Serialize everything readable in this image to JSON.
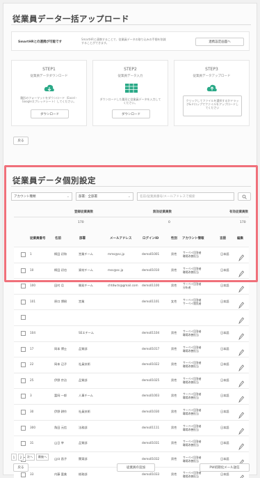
{
  "bulk": {
    "title": "従業員データ一括アップロード",
    "smarthr_label": "SmartHRとの連携が可能です",
    "smarthr_desc": "SmartHRと連携することで、従業員データの取り込みの手間を削減することができます。",
    "smarthr_button": "連携設定画面へ",
    "steps": [
      {
        "heading": "STEP1",
        "subtitle": "従業員データダウンロード",
        "desc": "雛形のフォーマットをダウンロード（Excel・Googleスプレッドシート）してください。",
        "button": "ダウンロード",
        "icon": "cloud-download-icon"
      },
      {
        "heading": "STEP2",
        "subtitle": "従業員データ入力",
        "desc": "ダウンロードした雛形に従業員データを入力してください。",
        "button": "ダウンロード",
        "icon": "spreadsheet-icon"
      },
      {
        "heading": "STEP3",
        "subtitle": "従業員データアップロード",
        "desc": "クリックしてファイルを選択するかドラッグ&ドロップでファイルをアップロードしてください",
        "button": "",
        "icon": "cloud-upload-icon"
      }
    ],
    "back_button": "戻る"
  },
  "individual": {
    "title": "従業員データ個別設定",
    "filter_account": "アカウント種類",
    "filter_dept": "部署：全部署",
    "search_placeholder": "名前/従業員番号/メールアドレスで検索",
    "stats": [
      {
        "label": "登録従業員数",
        "value": "170"
      },
      {
        "label": "無効従業員数",
        "value": "0"
      },
      {
        "label": "有効従業員数",
        "value": "170"
      }
    ],
    "columns": [
      "従業員番号",
      "名前",
      "部署",
      "メールアドレス",
      "ログインID",
      "性別",
      "アカウント情報",
      "言語",
      "編集"
    ],
    "rows": [
      {
        "num": "1",
        "name": "桐田 初和",
        "dept": "営業チーム",
        "email": "mms@sc.jp",
        "login": "demo01001",
        "gender": "男性",
        "account": [
          "サーベイ回答者",
          "職場改善担当"
        ],
        "lang": "日本語"
      },
      {
        "num": "10",
        "name": "桐田 初也",
        "dept": "資材チーム",
        "email": "mss@sc.jp",
        "login": "demo01010",
        "gender": "男性",
        "account": [
          "サーベイ回答者",
          "職場改善担当"
        ],
        "lang": "日本語"
      },
      {
        "num": "100",
        "name": "田村 月",
        "dept": "開発チーム",
        "email": "chtdw.ts@gmail.com",
        "login": "demo01100",
        "gender": "男性",
        "account": [
          "サーベイ回答者",
          "分析者"
        ],
        "lang": "日本語"
      },
      {
        "num": "101",
        "name": "原口 博樹",
        "dept": "営業",
        "email": "",
        "login": "demo01101",
        "gender": "女性",
        "account": [
          "サーベイ回答者",
          "サーベイ閲覧者"
        ],
        "lang": "日本語"
      },
      {
        "num": "",
        "name": "",
        "dept": "",
        "email": "",
        "login": "",
        "gender": "",
        "account": [
          "",
          ""
        ],
        "lang": ""
      },
      {
        "num": "104",
        "name": "",
        "dept": "SEエチーム",
        "email": "",
        "login": "demo01104",
        "gender": "男性",
        "account": [
          "サーベイ回答者",
          "職場改善担当"
        ],
        "lang": "日本語"
      },
      {
        "num": "17",
        "name": "岡本 博士",
        "dept": "品質部",
        "email": "",
        "login": "demo01017",
        "gender": "男性",
        "account": [
          "サーベイ回答者",
          "職場改善担当"
        ],
        "lang": "日本語"
      },
      {
        "num": "22",
        "name": "岡本 辺子",
        "dept": "社員技術",
        "email": "",
        "login": "demo01022",
        "gender": "男性",
        "account": [
          "サーベイ回答者",
          "職場改善担当"
        ],
        "lang": "日本語"
      },
      {
        "num": "25",
        "name": "伊野 宗治",
        "dept": "品質部",
        "email": "",
        "login": "demo01025",
        "gender": "男性",
        "account": [
          "サーベイ回答者",
          "職場改善担当"
        ],
        "lang": "日本語"
      },
      {
        "num": "3",
        "name": "富岡 一郎",
        "dept": "人事チーム",
        "email": "",
        "login": "demo01003",
        "gender": "男性",
        "account": [
          "サーベイ回答者",
          "職場改善担当"
        ],
        "lang": "日本語"
      },
      {
        "num": "30",
        "name": "伊野 耕作",
        "dept": "社員技術",
        "email": "",
        "login": "demo01030",
        "gender": "男性",
        "account": [
          "サーベイ回答者",
          "職場改善担当"
        ],
        "lang": "日本語"
      },
      {
        "num": "300",
        "name": "角田 元信",
        "dept": "法務部",
        "email": "",
        "login": "demo01111",
        "gender": "男性",
        "account": [
          "サーベイ回答者",
          "職場改善担当"
        ],
        "lang": "日本語"
      },
      {
        "num": "31",
        "name": "山日 宰",
        "dept": "品質部",
        "email": "",
        "login": "demo01031",
        "gender": "男性",
        "account": [
          "サーベイ回答者",
          "職場改善担当"
        ],
        "lang": "日本語"
      },
      {
        "num": "32",
        "name": "山口 昌子",
        "dept": "関東部",
        "email": "",
        "login": "demo01032",
        "gender": "男性",
        "account": [
          "サーベイ回答者",
          "職場改善担当"
        ],
        "lang": "日本語"
      },
      {
        "num": "33",
        "name": "内藤 富美",
        "dept": "総務部",
        "email": "",
        "login": "demo01033",
        "gender": "男性",
        "account": [
          "サーベイ回答者",
          "職場改善担当"
        ],
        "lang": "日本語"
      }
    ],
    "pagination": [
      "1",
      "2",
      "次へ",
      "最後へ"
    ],
    "back_button": "戻る",
    "add_button": "従業員の追加",
    "pw_button": "PW初期化メール送信"
  },
  "colors": {
    "accent": "#2aa987",
    "highlight": "#f0707a",
    "icon_green": "#2aa987"
  }
}
